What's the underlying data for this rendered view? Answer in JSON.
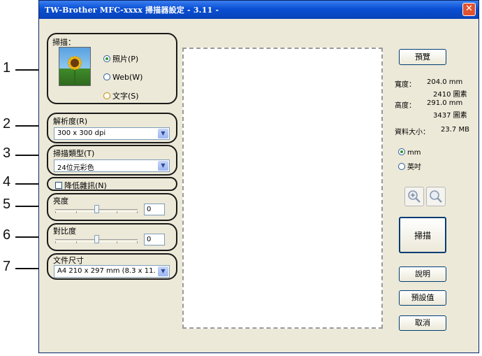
{
  "window": {
    "title": "TW-Brother MFC-xxxx 掃描器設定 - 3.11 -",
    "close_glyph": "✕"
  },
  "callouts": [
    "1",
    "2",
    "3",
    "4",
    "5",
    "6",
    "7"
  ],
  "scan_group": {
    "label": "掃描：",
    "options": [
      {
        "label": "照片(P)",
        "selected": true
      },
      {
        "label": "Web(W)",
        "selected": false
      },
      {
        "label": "文字(S)",
        "selected": false
      }
    ]
  },
  "resolution": {
    "label": "解析度(R)",
    "value": "300 x 300 dpi"
  },
  "scan_type": {
    "label": "掃描類型(T)",
    "value": "24位元彩色"
  },
  "noise": {
    "label": "降低雜訊(N)",
    "checked": false
  },
  "brightness": {
    "label": "亮度",
    "value": "0"
  },
  "contrast": {
    "label": "對比度",
    "value": "0"
  },
  "doc_size": {
    "label": "文件尺寸",
    "value": "A4 210 x 297 mm (8.3 x 11."
  },
  "right_panel": {
    "preview_button": "預覽",
    "width_label": "寬度：",
    "width_mm": "204.0 mm",
    "width_px": "2410 圖素",
    "height_label": "高度：",
    "height_mm": "291.0 mm",
    "height_px": "3437 圖素",
    "size_label": "資料大小：",
    "size_value": "23.7 MB",
    "unit_mm": "mm",
    "unit_inch": "英吋",
    "unit_selected": "mm",
    "scan_button": "掃描",
    "help_button": "說明",
    "default_button": "預設值",
    "cancel_button": "取消"
  },
  "icons": {
    "zoom_in": "zoom-in-icon",
    "zoom_out": "zoom-out-icon",
    "photo": "sunflower-photo-icon"
  }
}
